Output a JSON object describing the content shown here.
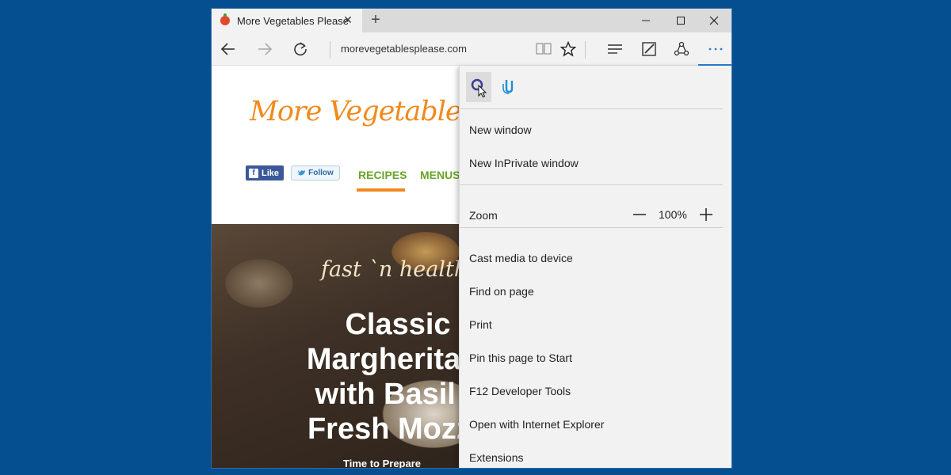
{
  "browser": {
    "tab_title": "More Vegetables Please",
    "tab_close": "✕",
    "new_tab": "+",
    "address": "morevegetablesplease.com"
  },
  "page": {
    "logo_text": "More Vegetables P",
    "like_label": "Like",
    "follow_label": "Follow",
    "nav_recipes": "RECIPES",
    "nav_menus": "MENUS",
    "hero_script": "fast `n healthy",
    "hero_title_lines": [
      "Classic",
      "Margherita P",
      "with Basil a",
      "Fresh Mozza"
    ],
    "hero_subtitle": "Time to Prepare"
  },
  "menu": {
    "items": {
      "new_window": "New window",
      "new_inprivate_window": "New InPrivate window",
      "zoom_label": "Zoom",
      "zoom_value": "100%",
      "cast_media": "Cast media to device",
      "find_on_page": "Find on page",
      "print": "Print",
      "pin_to_start": "Pin this page to Start",
      "dev_tools": "F12 Developer Tools",
      "open_with_ie": "Open with Internet Explorer",
      "extensions": "Extensions"
    }
  },
  "colors": {
    "desktop": "#054f91",
    "accent": "#2b7cd3",
    "logo_orange": "#f08a1c",
    "nav_green": "#6aa42a"
  }
}
